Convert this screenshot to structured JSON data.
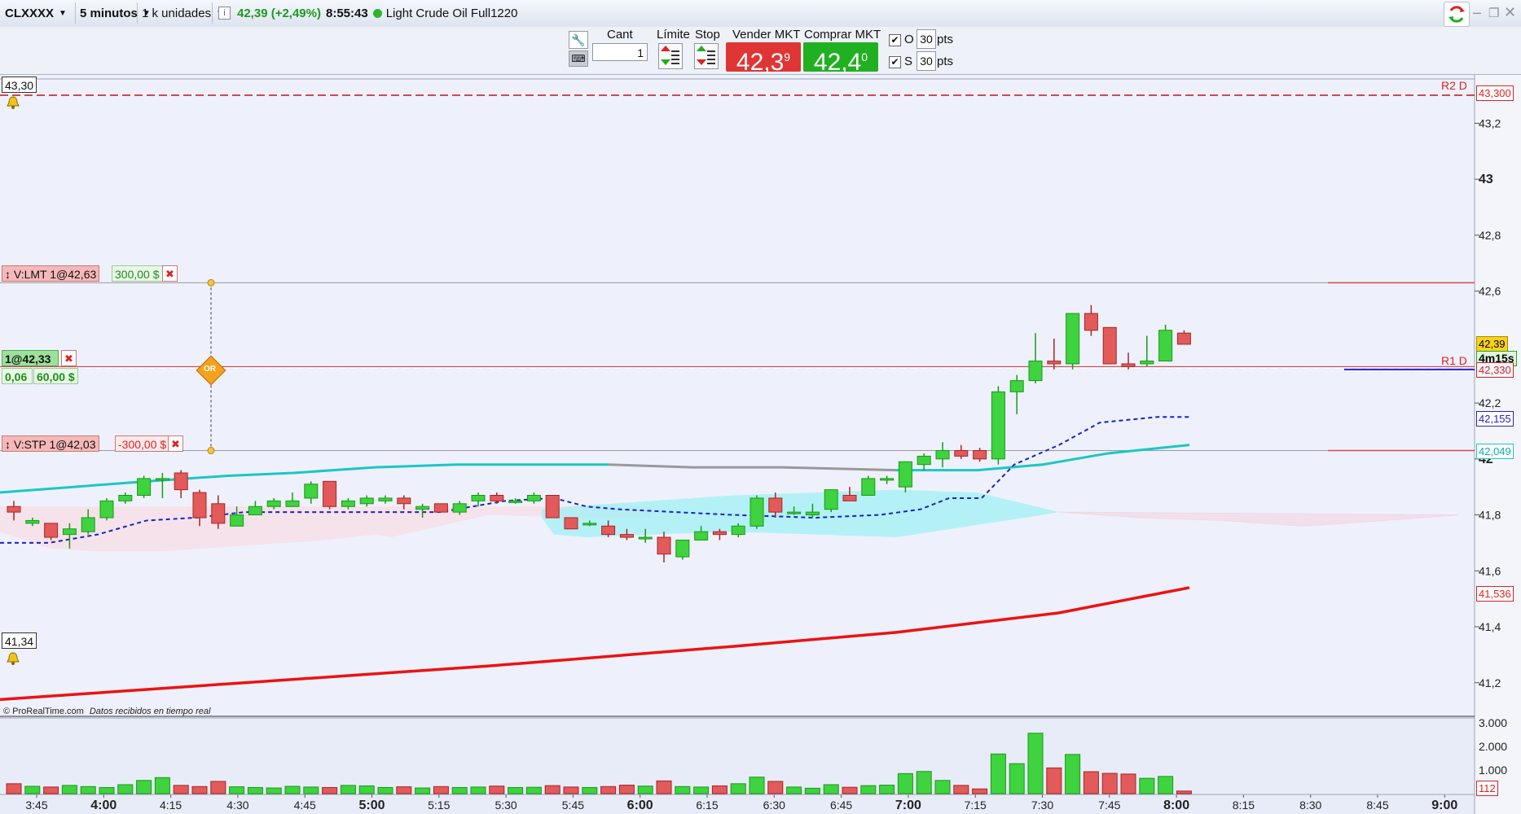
{
  "header": {
    "symbol": "CLXXXX",
    "timeframe": "5 minutos",
    "units": "1 k unidades",
    "info_icon": "i",
    "price_change": "42,39 (+2,49%)",
    "time": "8:55:43",
    "instrument": "Light Crude Oil Full1220",
    "icons": [
      "info-icon",
      "status-dot-icon",
      "refresh-icon",
      "minimize-icon",
      "restore-icon",
      "close-icon"
    ]
  },
  "order_bar": {
    "cant_label": "Cant",
    "qty_value": "1",
    "limit_label": "Límite",
    "stop_label": "Stop",
    "sell_label": "Vender MKT",
    "sell_price_main": "42,3",
    "sell_price_sup": "9",
    "buy_label": "Comprar MKT",
    "buy_price_main": "42,4",
    "buy_price_sup": "0",
    "o_label": "O",
    "o_value": "30",
    "s_label": "S",
    "s_value": "30",
    "pts_label": "pts",
    "check_mark": "✔",
    "sell_color": "#e03535",
    "buy_color": "#21b021"
  },
  "orders": {
    "limit_order": {
      "label": "V:LMT 1@42,63",
      "pnl": "300,00 $"
    },
    "position": {
      "label": "1@42,33",
      "points": "0,06",
      "pnl": "60,00 $"
    },
    "stop_order": {
      "label": "V:STP 1@42,03",
      "pnl": "-300,00 $"
    },
    "or_label": "OR",
    "close_glyph": "✖",
    "drag_glyph": "↕"
  },
  "price_tags": {
    "r2": "43,300",
    "current": "42,39",
    "countdown": "4m15s",
    "r1": "42,330",
    "ma_blue": "42,155",
    "ma_teal": "42,049",
    "ma_red": "41,536",
    "volume_last": "112"
  },
  "labels": {
    "top_left_price": "43,30",
    "bottom_left_price": "41,34",
    "r2_label": "R2 D",
    "r1_label": "R1 D",
    "footer_brand": "© ProRealTime.com",
    "footer_note": "Datos recibidos en tiempo real"
  },
  "chart_data": {
    "type": "candlestick",
    "ylim": [
      41.08,
      43.37
    ],
    "y_ticks": [
      "43,2",
      "43",
      "42,8",
      "42,6",
      "42,2",
      "42",
      "41,8",
      "41,6",
      "41,4",
      "41,2"
    ],
    "x_ticks": [
      "3:45",
      "4:00",
      "4:15",
      "4:30",
      "4:45",
      "5:00",
      "5:15",
      "5:30",
      "5:45",
      "6:00",
      "6:15",
      "6:30",
      "6:45",
      "7:00",
      "7:15",
      "7:30",
      "7:45",
      "8:00",
      "8:15",
      "8:30",
      "8:45",
      "9:00"
    ],
    "volume_ticks": [
      "3.000",
      "2.000",
      "1.000"
    ],
    "candles": [
      {
        "o": 41.83,
        "h": 41.85,
        "l": 41.78,
        "c": 41.81
      },
      {
        "o": 41.77,
        "h": 41.79,
        "l": 41.76,
        "c": 41.78
      },
      {
        "o": 41.77,
        "h": 41.77,
        "l": 41.71,
        "c": 41.72
      },
      {
        "o": 41.73,
        "h": 41.77,
        "l": 41.68,
        "c": 41.75
      },
      {
        "o": 41.74,
        "h": 41.82,
        "l": 41.73,
        "c": 41.79
      },
      {
        "o": 41.79,
        "h": 41.86,
        "l": 41.78,
        "c": 41.85
      },
      {
        "o": 41.85,
        "h": 41.88,
        "l": 41.84,
        "c": 41.87
      },
      {
        "o": 41.87,
        "h": 41.94,
        "l": 41.86,
        "c": 41.93
      },
      {
        "o": 41.93,
        "h": 41.95,
        "l": 41.86,
        "c": 41.93
      },
      {
        "o": 41.95,
        "h": 41.96,
        "l": 41.86,
        "c": 41.89
      },
      {
        "o": 41.88,
        "h": 41.89,
        "l": 41.76,
        "c": 41.79
      },
      {
        "o": 41.84,
        "h": 41.87,
        "l": 41.75,
        "c": 41.77
      },
      {
        "o": 41.76,
        "h": 41.83,
        "l": 41.76,
        "c": 41.8
      },
      {
        "o": 41.8,
        "h": 41.85,
        "l": 41.8,
        "c": 41.83
      },
      {
        "o": 41.83,
        "h": 41.86,
        "l": 41.82,
        "c": 41.85
      },
      {
        "o": 41.83,
        "h": 41.88,
        "l": 41.83,
        "c": 41.85
      },
      {
        "o": 41.86,
        "h": 41.92,
        "l": 41.84,
        "c": 41.91
      },
      {
        "o": 41.92,
        "h": 41.92,
        "l": 41.82,
        "c": 41.83
      },
      {
        "o": 41.83,
        "h": 41.86,
        "l": 41.82,
        "c": 41.85
      },
      {
        "o": 41.84,
        "h": 41.87,
        "l": 41.83,
        "c": 41.86
      },
      {
        "o": 41.85,
        "h": 41.87,
        "l": 41.84,
        "c": 41.86
      },
      {
        "o": 41.86,
        "h": 41.87,
        "l": 41.82,
        "c": 41.84
      },
      {
        "o": 41.82,
        "h": 41.84,
        "l": 41.79,
        "c": 41.83
      },
      {
        "o": 41.84,
        "h": 41.84,
        "l": 41.81,
        "c": 41.81
      },
      {
        "o": 41.81,
        "h": 41.85,
        "l": 41.8,
        "c": 41.84
      },
      {
        "o": 41.85,
        "h": 41.88,
        "l": 41.83,
        "c": 41.87
      },
      {
        "o": 41.87,
        "h": 41.88,
        "l": 41.84,
        "c": 41.85
      },
      {
        "o": 41.85,
        "h": 41.86,
        "l": 41.84,
        "c": 41.85
      },
      {
        "o": 41.85,
        "h": 41.88,
        "l": 41.84,
        "c": 41.87
      },
      {
        "o": 41.87,
        "h": 41.87,
        "l": 41.79,
        "c": 41.79
      },
      {
        "o": 41.79,
        "h": 41.79,
        "l": 41.75,
        "c": 41.75
      },
      {
        "o": 41.77,
        "h": 41.78,
        "l": 41.76,
        "c": 41.77
      },
      {
        "o": 41.76,
        "h": 41.78,
        "l": 41.72,
        "c": 41.73
      },
      {
        "o": 41.73,
        "h": 41.75,
        "l": 41.71,
        "c": 41.72
      },
      {
        "o": 41.72,
        "h": 41.75,
        "l": 41.7,
        "c": 41.72
      },
      {
        "o": 41.72,
        "h": 41.74,
        "l": 41.63,
        "c": 41.66
      },
      {
        "o": 41.65,
        "h": 41.71,
        "l": 41.64,
        "c": 41.71
      },
      {
        "o": 41.71,
        "h": 41.76,
        "l": 41.71,
        "c": 41.74
      },
      {
        "o": 41.74,
        "h": 41.75,
        "l": 41.71,
        "c": 41.73
      },
      {
        "o": 41.73,
        "h": 41.77,
        "l": 41.72,
        "c": 41.76
      },
      {
        "o": 41.76,
        "h": 41.87,
        "l": 41.75,
        "c": 41.86
      },
      {
        "o": 41.86,
        "h": 41.88,
        "l": 41.79,
        "c": 41.81
      },
      {
        "o": 41.81,
        "h": 41.83,
        "l": 41.8,
        "c": 41.81
      },
      {
        "o": 41.8,
        "h": 41.84,
        "l": 41.79,
        "c": 41.81
      },
      {
        "o": 41.82,
        "h": 41.89,
        "l": 41.81,
        "c": 41.89
      },
      {
        "o": 41.87,
        "h": 41.9,
        "l": 41.85,
        "c": 41.85
      },
      {
        "o": 41.87,
        "h": 41.94,
        "l": 41.87,
        "c": 41.93
      },
      {
        "o": 41.93,
        "h": 41.94,
        "l": 41.91,
        "c": 41.93
      },
      {
        "o": 41.9,
        "h": 41.99,
        "l": 41.88,
        "c": 41.99
      },
      {
        "o": 41.98,
        "h": 42.02,
        "l": 41.96,
        "c": 42.01
      },
      {
        "o": 42.0,
        "h": 42.06,
        "l": 41.97,
        "c": 42.03
      },
      {
        "o": 42.03,
        "h": 42.05,
        "l": 42.0,
        "c": 42.01
      },
      {
        "o": 42.03,
        "h": 42.04,
        "l": 41.99,
        "c": 42.0
      },
      {
        "o": 42.0,
        "h": 42.26,
        "l": 41.98,
        "c": 42.24
      },
      {
        "o": 42.24,
        "h": 42.3,
        "l": 42.16,
        "c": 42.28
      },
      {
        "o": 42.28,
        "h": 42.45,
        "l": 42.27,
        "c": 42.35
      },
      {
        "o": 42.35,
        "h": 42.43,
        "l": 42.32,
        "c": 42.34
      },
      {
        "o": 42.34,
        "h": 42.52,
        "l": 42.32,
        "c": 42.52
      },
      {
        "o": 42.52,
        "h": 42.55,
        "l": 42.44,
        "c": 42.46
      },
      {
        "o": 42.47,
        "h": 42.47,
        "l": 42.34,
        "c": 42.34
      },
      {
        "o": 42.34,
        "h": 42.38,
        "l": 42.32,
        "c": 42.33
      },
      {
        "o": 42.34,
        "h": 42.44,
        "l": 42.33,
        "c": 42.35
      },
      {
        "o": 42.35,
        "h": 42.48,
        "l": 42.35,
        "c": 42.46
      },
      {
        "o": 42.45,
        "h": 42.46,
        "l": 42.41,
        "c": 42.41
      }
    ],
    "volumes": [
      420,
      310,
      280,
      350,
      300,
      260,
      380,
      560,
      680,
      350,
      300,
      520,
      290,
      260,
      240,
      310,
      280,
      260,
      350,
      330,
      260,
      290,
      240,
      300,
      260,
      280,
      320,
      260,
      270,
      340,
      280,
      260,
      300,
      360,
      320,
      540,
      300,
      280,
      330,
      420,
      700,
      520,
      280,
      230,
      380,
      270,
      340,
      360,
      850,
      940,
      560,
      350,
      200,
      1680,
      1270,
      2560,
      1090,
      1660,
      930,
      860,
      830,
      650,
      730,
      110
    ],
    "lines": {
      "teal_ma": [
        [
          0,
          41.88
        ],
        [
          90,
          41.9
        ],
        [
          180,
          41.92
        ],
        [
          280,
          41.94
        ],
        [
          360,
          41.95
        ],
        [
          460,
          41.97
        ],
        [
          560,
          41.98
        ],
        [
          660,
          41.98
        ],
        [
          747,
          41.98
        ]
      ],
      "gray_ma": [
        [
          747,
          41.98
        ],
        [
          850,
          41.97
        ],
        [
          960,
          41.97
        ],
        [
          1100,
          41.96
        ]
      ],
      "teal_ma2": [
        [
          1100,
          41.96
        ],
        [
          1200,
          41.96
        ],
        [
          1280,
          41.98
        ],
        [
          1360,
          42.02
        ],
        [
          1460,
          42.05
        ]
      ],
      "blue_dashed": [
        [
          0,
          41.7
        ],
        [
          60,
          41.7
        ],
        [
          120,
          41.73
        ],
        [
          180,
          41.78
        ],
        [
          240,
          41.79
        ],
        [
          300,
          41.81
        ],
        [
          380,
          41.81
        ],
        [
          460,
          41.81
        ],
        [
          540,
          41.81
        ],
        [
          620,
          41.85
        ],
        [
          680,
          41.86
        ],
        [
          720,
          41.83
        ],
        [
          760,
          41.82
        ],
        [
          900,
          41.8
        ],
        [
          1000,
          41.79
        ],
        [
          1080,
          41.8
        ],
        [
          1130,
          41.82
        ],
        [
          1165,
          41.86
        ],
        [
          1205,
          41.86
        ],
        [
          1245,
          41.98
        ],
        [
          1300,
          42.05
        ],
        [
          1350,
          42.13
        ],
        [
          1420,
          42.15
        ],
        [
          1460,
          42.15
        ]
      ],
      "red_ma": [
        [
          0,
          41.14
        ],
        [
          300,
          41.2
        ],
        [
          600,
          41.26
        ],
        [
          900,
          41.33
        ],
        [
          1100,
          41.38
        ],
        [
          1300,
          41.45
        ],
        [
          1460,
          41.54
        ]
      ]
    }
  }
}
